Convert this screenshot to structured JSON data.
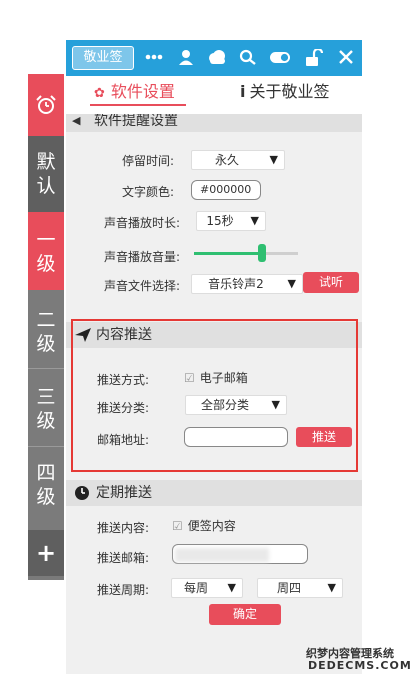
{
  "toolbar": {
    "brand": "敬业签",
    "icons": [
      "more-icon",
      "user-icon",
      "cloud-icon",
      "search-icon",
      "toggle-icon",
      "unlock-icon",
      "close-icon"
    ],
    "accent": "#26a0da"
  },
  "tabs": {
    "settings": "软件设置",
    "about": "关于敬业签",
    "about_prefix": "i"
  },
  "sidenav": {
    "items": [
      "默认",
      "一级",
      "二级",
      "三级",
      "四级"
    ],
    "add": "+",
    "accent": "#e84d5b"
  },
  "reminder": {
    "header": "软件提醒设置",
    "stay_label": "停留时间:",
    "stay_value": "永久",
    "color_label": "文字颜色:",
    "color_value": "#000000",
    "duration_label": "声音播放时长:",
    "duration_value": "15秒",
    "volume_label": "声音播放音量:",
    "volume_level": 0.65,
    "file_label": "声音文件选择:",
    "file_value": "音乐铃声2",
    "test_button": "试听"
  },
  "push": {
    "header": "内容推送",
    "method_label": "推送方式:",
    "method_value": "电子邮箱",
    "category_label": "推送分类:",
    "category_value": "全部分类",
    "email_label": "邮箱地址:",
    "email_value": "",
    "push_button": "推送"
  },
  "scheduled": {
    "header": "定期推送",
    "content_label": "推送内容:",
    "content_value": "便签内容",
    "email_label": "推送邮箱:",
    "email_value": "",
    "period_label": "推送周期:",
    "period_value": "每周",
    "day_value": "周四",
    "confirm_button": "确定"
  },
  "watermark": {
    "line1": "织梦内容管理系统",
    "line2": "DEDECMS.COM"
  }
}
